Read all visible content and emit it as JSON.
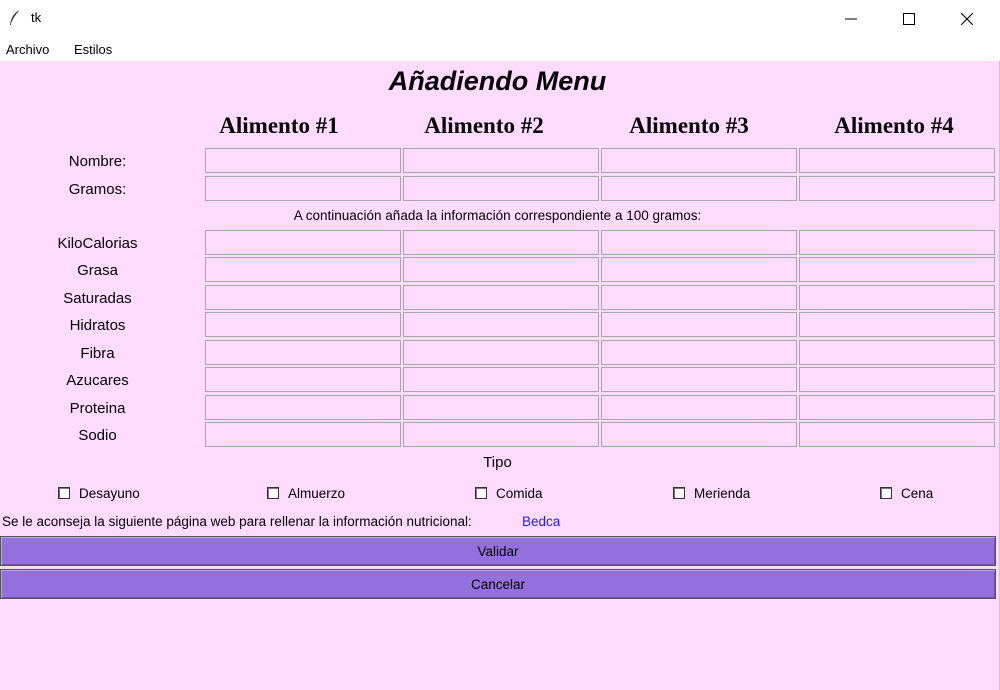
{
  "window": {
    "title": "tk",
    "icon": "feather-icon",
    "controls": [
      "minimize-icon",
      "maximize-icon",
      "close-icon"
    ]
  },
  "menubar": {
    "items": [
      "Archivo",
      "Estilos"
    ]
  },
  "form": {
    "title": "Añadiendo Menu",
    "columns": [
      "Alimento #1",
      "Alimento #2",
      "Alimento #3",
      "Alimento #4"
    ],
    "basic_rows": [
      "Nombre:",
      "Gramos:"
    ],
    "info_text": "A continuación añada la información correspondiente a 100 gramos:",
    "nutrient_rows": [
      "KiloCalorias",
      "Grasa",
      "Saturadas",
      "Hidratos",
      "Fibra",
      "Azucares",
      "Proteina",
      "Sodio"
    ],
    "field_values": {
      "basic": [
        [
          "",
          "",
          "",
          ""
        ],
        [
          "",
          "",
          "",
          ""
        ]
      ],
      "nutrients": [
        [
          "",
          "",
          "",
          ""
        ],
        [
          "",
          "",
          "",
          ""
        ],
        [
          "",
          "",
          "",
          ""
        ],
        [
          "",
          "",
          "",
          ""
        ],
        [
          "",
          "",
          "",
          ""
        ],
        [
          "",
          "",
          "",
          ""
        ],
        [
          "",
          "",
          "",
          ""
        ],
        [
          "",
          "",
          "",
          ""
        ]
      ]
    },
    "tipo_label": "Tipo",
    "tipo_options": [
      {
        "label": "Desayuno",
        "checked": false
      },
      {
        "label": "Almuerzo",
        "checked": false
      },
      {
        "label": "Comida",
        "checked": false
      },
      {
        "label": "Merienda",
        "checked": false
      },
      {
        "label": "Cena",
        "checked": false
      }
    ],
    "advice_text": "Se le aconseja la siguiente página web para rellenar la información nutricional:",
    "advice_link": "Bedca",
    "validate_label": "Validar",
    "cancel_label": "Cancelar"
  },
  "colors": {
    "background": "#ffdcff",
    "button": "#9370db",
    "link": "#1a1aff"
  }
}
